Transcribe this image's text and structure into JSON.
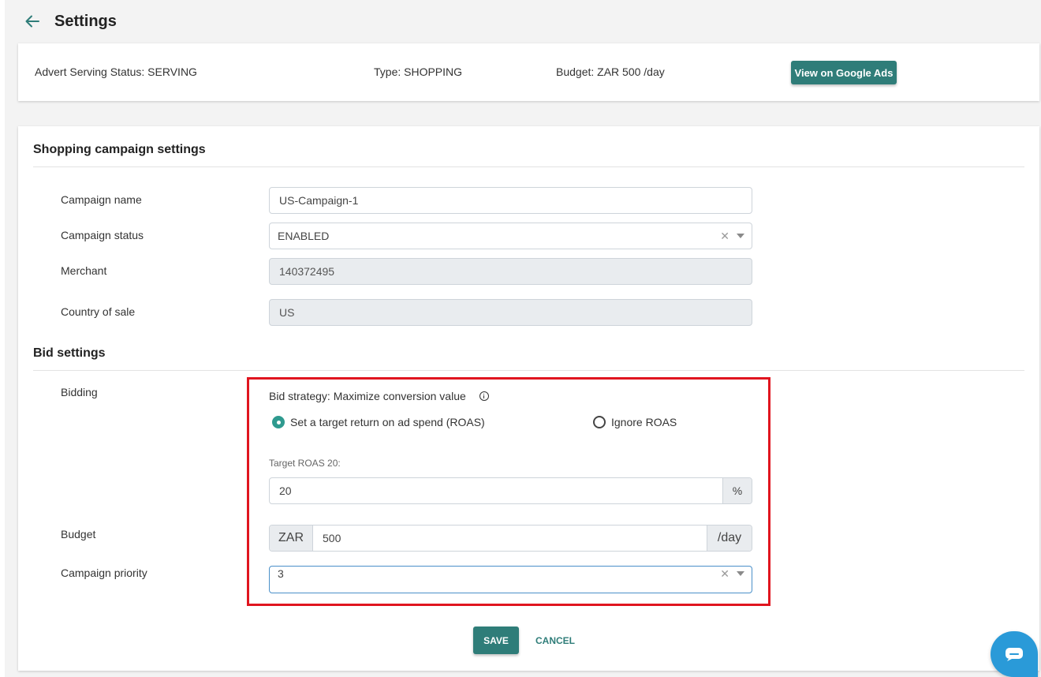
{
  "page": {
    "title": "Settings"
  },
  "summary": {
    "serving_status": "Advert Serving Status: SERVING",
    "type": "Type: SHOPPING",
    "budget": "Budget: ZAR 500 /day",
    "google_ads_button": "View on Google Ads"
  },
  "shopping": {
    "section_title": "Shopping campaign settings",
    "campaign_name_label": "Campaign name",
    "campaign_name_value": "US-Campaign-1",
    "campaign_status_label": "Campaign status",
    "campaign_status_value": "ENABLED",
    "merchant_label": "Merchant",
    "merchant_value": "140372495",
    "country_label": "Country of sale",
    "country_value": "US"
  },
  "bid": {
    "section_title": "Bid settings",
    "bidding_label": "Bidding",
    "bid_strategy": "Bid strategy: Maximize conversion value",
    "option_target_roas": "Set a target return on ad spend (ROAS)",
    "option_ignore_roas": "Ignore ROAS",
    "selected_option": "Set a target return on ad spend (ROAS)",
    "target_roas_label": "Target ROAS 20:",
    "target_roas_value": "20",
    "target_roas_unit": "%",
    "budget_label": "Budget",
    "budget_currency": "ZAR",
    "budget_value": "500",
    "budget_unit": "/day",
    "priority_label": "Campaign priority",
    "priority_value": "3"
  },
  "actions": {
    "save": "SAVE",
    "cancel": "CANCEL"
  },
  "colors": {
    "primary": "#2f7d79",
    "radio_accent": "#2f9a8f",
    "highlight": "#e0151f",
    "chat": "#2a9ad8"
  },
  "icons": {
    "back": "arrow-left-icon",
    "info": "info-icon",
    "clear": "clear-icon",
    "dropdown": "chevron-down-icon",
    "chat": "chat-icon"
  }
}
